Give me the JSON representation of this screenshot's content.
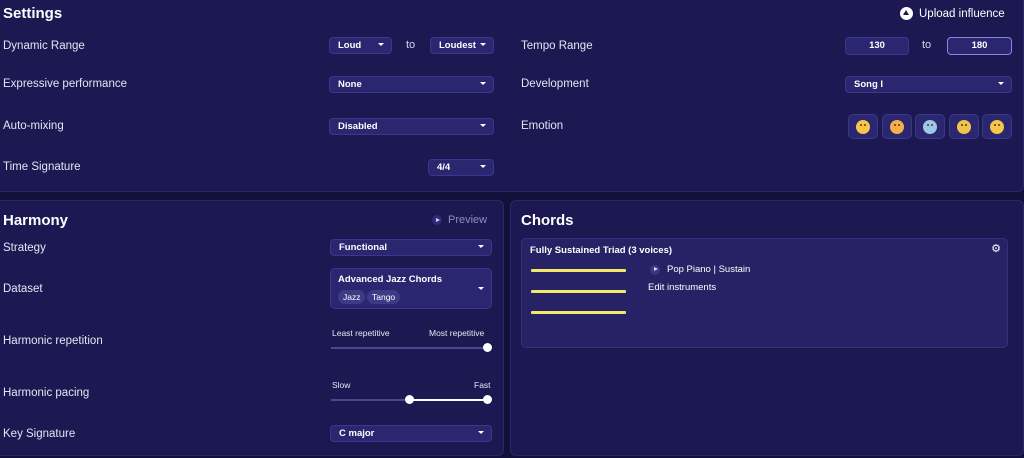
{
  "settings": {
    "title": "Settings",
    "upload_label": "Upload influence",
    "dynamic_range": {
      "label": "Dynamic Range",
      "from": "Loud",
      "to_word": "to",
      "to": "Loudest"
    },
    "expressive": {
      "label": "Expressive performance",
      "value": "None"
    },
    "auto_mixing": {
      "label": "Auto-mixing",
      "value": "Disabled"
    },
    "time_signature": {
      "label": "Time Signature",
      "value": "4/4"
    },
    "tempo_range": {
      "label": "Tempo Range",
      "min": "130",
      "to_word": "to",
      "max": "180"
    },
    "development": {
      "label": "Development",
      "value": "Song I"
    },
    "emotion": {
      "label": "Emotion",
      "options": [
        {
          "icon": "relieved-face-icon",
          "color": "#f6c64a"
        },
        {
          "icon": "party-face-icon",
          "color": "#f6b04a"
        },
        {
          "icon": "anxious-face-icon",
          "color": "#9cc7e8"
        },
        {
          "icon": "crying-face-icon",
          "color": "#f2c24e"
        },
        {
          "icon": "grimacing-face-icon",
          "color": "#f6c64a"
        }
      ]
    }
  },
  "harmony": {
    "title": "Harmony",
    "preview_label": "Preview",
    "strategy": {
      "label": "Strategy",
      "value": "Functional"
    },
    "dataset": {
      "label": "Dataset",
      "value": "Advanced Jazz Chords",
      "tags": [
        "Jazz",
        "Tango"
      ]
    },
    "repetition": {
      "label": "Harmonic repetition",
      "min_label": "Least repetitive",
      "max_label": "Most repetitive",
      "value": 1.0
    },
    "pacing": {
      "label": "Harmonic pacing",
      "min_label": "Slow",
      "max_label": "Fast",
      "low": 0.5,
      "high": 1.0
    },
    "key_signature": {
      "label": "Key Signature",
      "value": "C major"
    }
  },
  "chords": {
    "title": "Chords",
    "card": {
      "title": "Fully Sustained Triad (3 voices)",
      "instrument": "Pop Piano | Sustain",
      "edit_label": "Edit instruments",
      "voice_color": "#f2e86a"
    }
  }
}
